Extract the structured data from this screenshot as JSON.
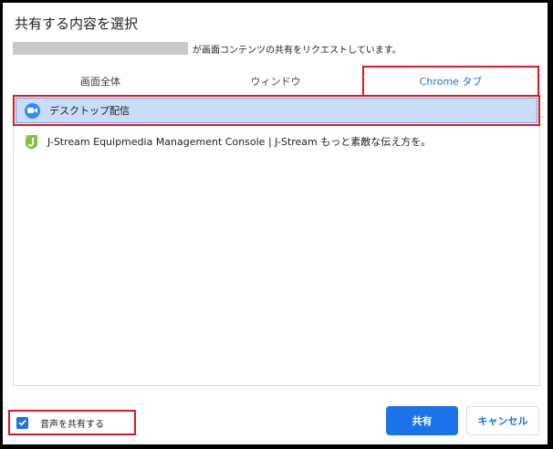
{
  "dialog": {
    "title": "共有する内容を選択",
    "subtitle": "が画面コンテンツの共有をリクエストしています。"
  },
  "tabs": [
    {
      "label": "画面全体"
    },
    {
      "label": "ウィンドウ"
    },
    {
      "label": "Chrome タブ"
    }
  ],
  "list": {
    "items": [
      {
        "label": "デスクトップ配信",
        "icon": "zoom-camera-icon",
        "selected": true
      },
      {
        "label": "J-Stream Equipmedia Management Console | J-Stream もっと素敵な伝え方を。",
        "icon": "j-stream-logo-icon",
        "selected": false
      }
    ]
  },
  "audio": {
    "label": "音声を共有する",
    "checked": true
  },
  "buttons": {
    "share": "共有",
    "cancel": "キャンセル"
  },
  "colors": {
    "accent": "#1a73e8",
    "highlight": "#e8141e",
    "selected_bg": "#c9dcf8"
  }
}
